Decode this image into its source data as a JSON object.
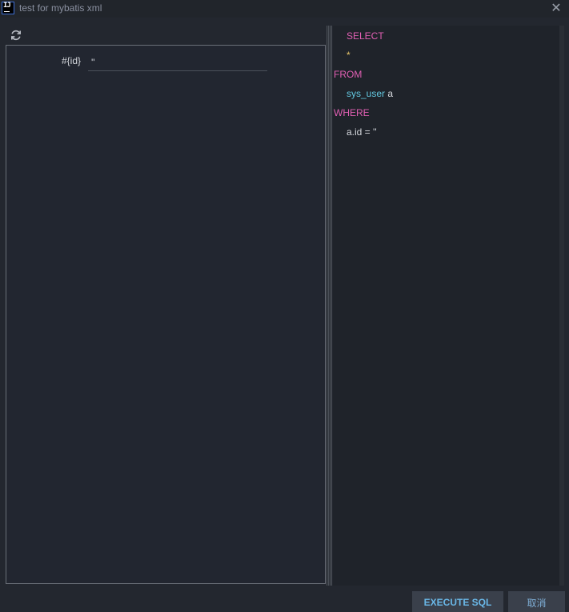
{
  "window": {
    "title": "test for mybatis xml",
    "app_icon_text": "IJ",
    "icons": {
      "app": "intellij-idea-icon",
      "close": "close-icon",
      "refresh": "refresh-icon"
    }
  },
  "params": [
    {
      "name": "#{id}",
      "value": "''"
    }
  ],
  "sql": {
    "select": "SELECT",
    "star": "*",
    "from": "FROM",
    "table": "sys_user",
    "alias": "a",
    "where": "WHERE",
    "condition": "a.id = ''"
  },
  "buttons": {
    "execute": "EXECUTE SQL",
    "cancel": "取消"
  },
  "colors": {
    "keyword": "#e05fb3",
    "table": "#63c8e0",
    "background": "#23272f"
  }
}
